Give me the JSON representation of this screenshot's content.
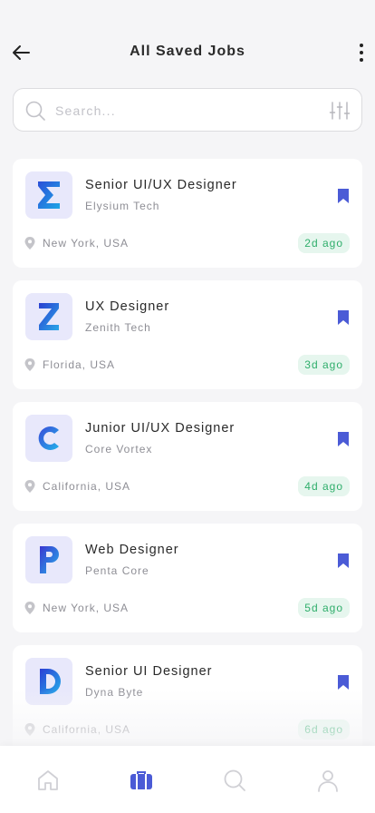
{
  "header": {
    "title": "All Saved Jobs",
    "back_icon": "arrow-left-icon",
    "menu_icon": "more-vertical-icon"
  },
  "search": {
    "placeholder": "Search...",
    "value": "",
    "filter_icon": "sliders-icon"
  },
  "colors": {
    "accent": "#4b5bd6",
    "badge_bg": "#e6f6ee",
    "badge_text": "#2fae6b",
    "logo_bg": "#e8e8fb"
  },
  "jobs": [
    {
      "title": "Senior UI/UX Designer",
      "company": "Elysium Tech",
      "location": "New York, USA",
      "posted": "2d ago",
      "logo_icon": "sigma-logo-icon"
    },
    {
      "title": "UX Designer",
      "company": "Zenith Tech",
      "location": "Florida, USA",
      "posted": "3d ago",
      "logo_icon": "z-logo-icon"
    },
    {
      "title": "Junior UI/UX Designer",
      "company": "Core Vortex",
      "location": "California, USA",
      "posted": "4d ago",
      "logo_icon": "c-logo-icon"
    },
    {
      "title": "Web Designer",
      "company": "Penta Core",
      "location": "New York, USA",
      "posted": "5d ago",
      "logo_icon": "p-logo-icon"
    },
    {
      "title": "Senior UI Designer",
      "company": "Dyna Byte",
      "location": "California, USA",
      "posted": "6d ago",
      "logo_icon": "d-logo-icon"
    }
  ],
  "nav": {
    "items": [
      {
        "icon": "home-icon",
        "active": false
      },
      {
        "icon": "briefcase-icon",
        "active": true
      },
      {
        "icon": "search-icon",
        "active": false
      },
      {
        "icon": "profile-icon",
        "active": false
      }
    ]
  }
}
